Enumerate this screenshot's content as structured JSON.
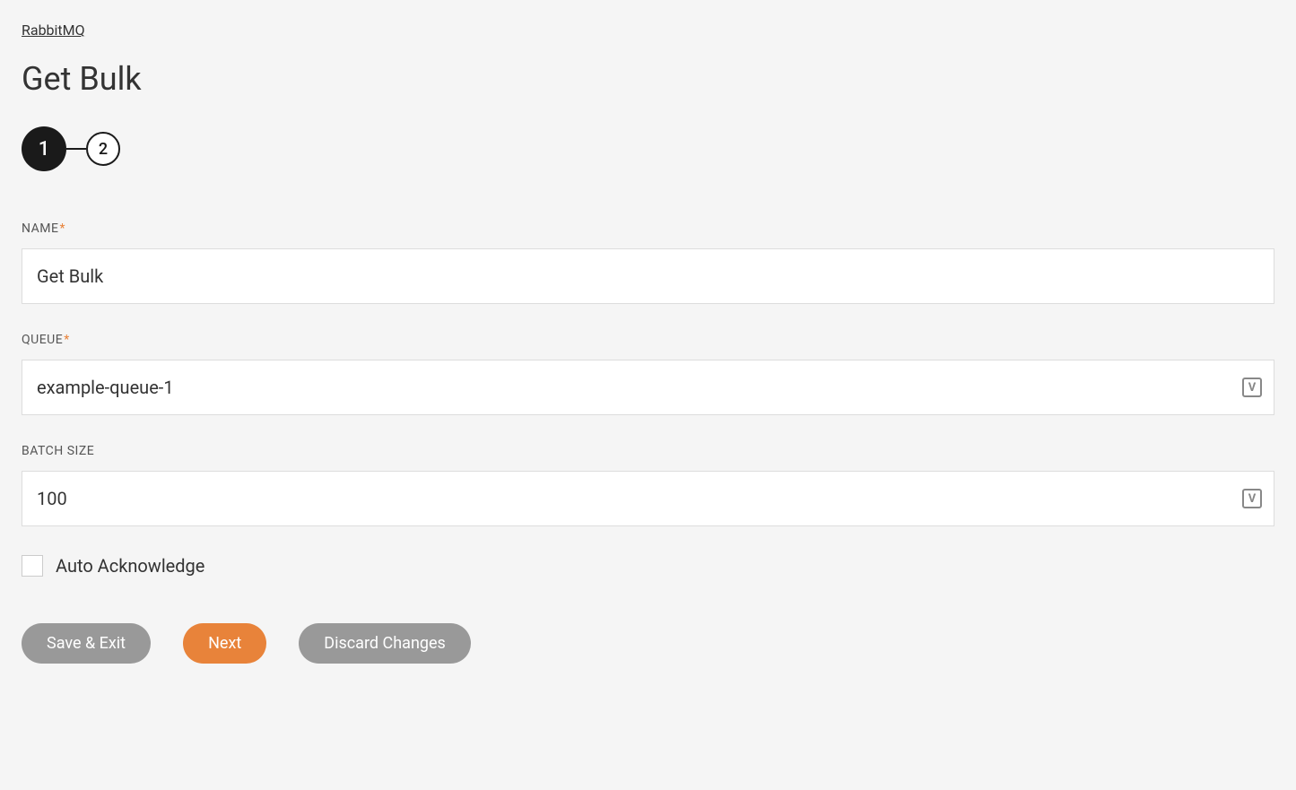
{
  "breadcrumb": {
    "label": "RabbitMQ"
  },
  "page": {
    "title": "Get Bulk"
  },
  "stepper": {
    "step1": "1",
    "step2": "2"
  },
  "form": {
    "name": {
      "label": "NAME",
      "value": "Get Bulk",
      "required": true
    },
    "queue": {
      "label": "QUEUE",
      "value": "example-queue-1",
      "required": true
    },
    "batchSize": {
      "label": "BATCH SIZE",
      "value": "100",
      "required": false
    },
    "autoAck": {
      "label": "Auto Acknowledge",
      "checked": false
    }
  },
  "buttons": {
    "saveExit": "Save & Exit",
    "next": "Next",
    "discard": "Discard Changes"
  },
  "icons": {
    "variable": "V"
  }
}
